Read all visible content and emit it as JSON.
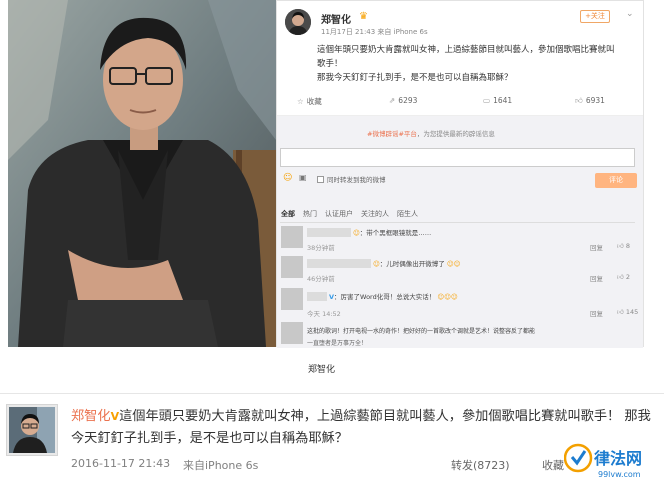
{
  "panel": {
    "name": "郑智化",
    "meta": "11月17日 21:43 来自 iPhone 6s",
    "follow": "+关注",
    "text_line1": "這個年頭只要奶大肯露就叫女神，上過綜藝節目就叫藝人，參加個歌唱比賽就叫",
    "text_line2": "歌手！",
    "text_line3": "那我今天釘釘子扎到手，是不是也可以自稱為耶穌？",
    "actions": {
      "favorite": "收藏",
      "forward": "6293",
      "comment": "1641",
      "like": "6931"
    },
    "topic_prefix": "#",
    "topic_name": "#微博辟谣#平台",
    "topic_suffix": "，为您提供最新的辟谣信息",
    "also_forward": "同时转发到我的微博",
    "submit": "评论",
    "tabs": [
      "全部",
      "热门",
      "认证用户",
      "关注的人",
      "陌生人"
    ],
    "comments": [
      {
        "text": "：带个黑框眼镜就是……",
        "time": "38分钟前",
        "reply": "回复",
        "likes": "8"
      },
      {
        "text": "：儿时偶像出开微博了",
        "time": "46分钟前",
        "reply": "回复",
        "likes": "2"
      },
      {
        "text": "：厉害了Word化哥！总说大实话！",
        "time": "今天 14:52",
        "reply": "回复",
        "likes": "145"
      },
      {
        "text": "这批的歌词！打开电视一水的奇作！把好好的一首歌改个调就是艺术！说整容反了都能",
        "time": "",
        "reply": "",
        "likes": ""
      }
    ],
    "last_line": "一直堕者是万事万全！"
  },
  "caption": "郑智化",
  "post": {
    "name": "郑智化",
    "verified": "V",
    "text": "這個年頭只要奶大肯露就叫女神，上過綜藝節目就叫藝人，參加個歌唱比賽就叫歌手！ 那我今天釘釘子扎到手，是不是也可以自稱為耶穌？",
    "date": "2016-11-17 21:43",
    "source": "来自iPhone 6s",
    "forward": "转发(8723)",
    "favorite": "收藏"
  },
  "watermark": {
    "text": "律法网",
    "sub": "99lvw.com"
  },
  "colors": {
    "link_orange": "#eb7350",
    "vip_yellow": "#f7a000",
    "watermark_blue": "#1d7ccf"
  }
}
